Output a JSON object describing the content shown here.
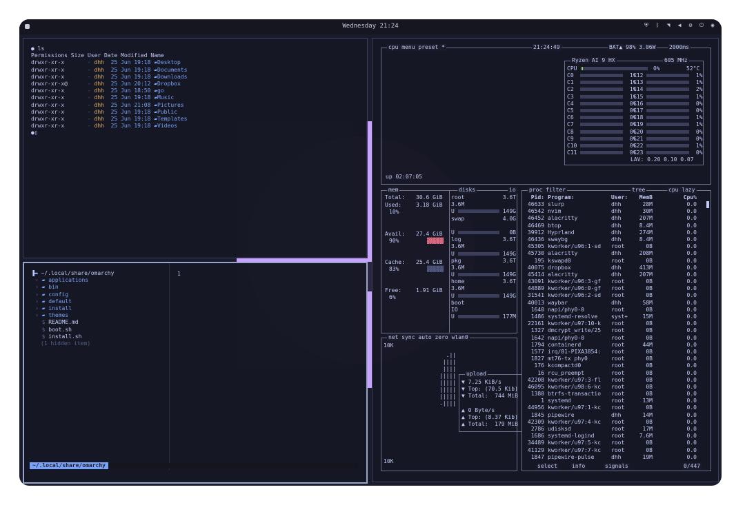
{
  "topbar": {
    "clock": "Wednesday 21:24",
    "tray_icons": [
      "shield-icon",
      "bluetooth-icon",
      "wifi-icon",
      "volume-icon",
      "settings-icon",
      "power-icon",
      "menu-icon"
    ]
  },
  "terminal": {
    "command": "ls",
    "header": "Permissions Size User Date Modified Name",
    "rows": [
      {
        "perm": "drwxr-xr-x",
        "size": "-",
        "user": "dhh",
        "date": "25 Jun 19:18",
        "name": "Desktop"
      },
      {
        "perm": "drwxr-xr-x",
        "size": "-",
        "user": "dhh",
        "date": "25 Jun 19:18",
        "name": "Documents"
      },
      {
        "perm": "drwxr-xr-x",
        "size": "-",
        "user": "dhh",
        "date": "25 Jun 19:18",
        "name": "Downloads"
      },
      {
        "perm": "drwxr-xr-x@",
        "size": "-",
        "user": "dhh",
        "date": "25 Jun 20:12",
        "name": "Dropbox"
      },
      {
        "perm": "drwxr-xr-x",
        "size": "-",
        "user": "dhh",
        "date": "25 Jun 18:50",
        "name": "go"
      },
      {
        "perm": "drwxr-xr-x",
        "size": "-",
        "user": "dhh",
        "date": "25 Jun 19:18",
        "name": "Music"
      },
      {
        "perm": "drwxr-xr-x",
        "size": "-",
        "user": "dhh",
        "date": "25 Jun 21:08",
        "name": "Pictures"
      },
      {
        "perm": "drwxr-xr-x",
        "size": "-",
        "user": "dhh",
        "date": "25 Jun 19:18",
        "name": "Public"
      },
      {
        "perm": "drwxr-xr-x",
        "size": "-",
        "user": "dhh",
        "date": "25 Jun 19:18",
        "name": "Templates"
      },
      {
        "perm": "drwxr-xr-x",
        "size": "-",
        "user": "dhh",
        "date": "25 Jun 19:18",
        "name": "Videos"
      }
    ]
  },
  "yazi": {
    "path": "~/.local/share/omarchy",
    "items": [
      {
        "icon": "folder",
        "name": "applications"
      },
      {
        "icon": "folder",
        "name": "bin"
      },
      {
        "icon": "folder",
        "name": "config"
      },
      {
        "icon": "folder",
        "name": "default"
      },
      {
        "icon": "folder",
        "name": "install"
      },
      {
        "icon": "folder",
        "name": "themes"
      },
      {
        "icon": "file",
        "name": "README.md"
      },
      {
        "icon": "file",
        "name": "boot.sh"
      },
      {
        "icon": "file",
        "name": "install.sh"
      }
    ],
    "hidden": "(1 hidden item)",
    "preview_line": "1",
    "status_path": "~/.local/share/omarchy"
  },
  "btop": {
    "cpu_tabs": [
      "cpu",
      "menu",
      "preset",
      "*"
    ],
    "time": "21:24:49",
    "battery": "BAT▲ 98% 3.06W",
    "refresh": "2000ms",
    "cpu_name": "Ryzen AI 9 HX",
    "freq": "605 MHz",
    "cpu_total": "0%",
    "cpu_temp": "52°C",
    "cores_left": [
      [
        "C0",
        "1%"
      ],
      [
        "C1",
        "1%"
      ],
      [
        "C2",
        "1%"
      ],
      [
        "C3",
        "1%"
      ],
      [
        "C4",
        "0%"
      ],
      [
        "C5",
        "0%"
      ],
      [
        "C6",
        "0%"
      ],
      [
        "C7",
        "0%"
      ],
      [
        "C8",
        "0%"
      ],
      [
        "C9",
        "0%"
      ],
      [
        "C10",
        "0%"
      ],
      [
        "C11",
        "0%"
      ]
    ],
    "cores_right": [
      [
        "C12",
        "1%"
      ],
      [
        "C13",
        "1%"
      ],
      [
        "C14",
        "2%"
      ],
      [
        "C15",
        "1%"
      ],
      [
        "C16",
        "0%"
      ],
      [
        "C17",
        "0%"
      ],
      [
        "C18",
        "1%"
      ],
      [
        "C19",
        "1%"
      ],
      [
        "C20",
        "0%"
      ],
      [
        "C21",
        "0%"
      ],
      [
        "C22",
        "1%"
      ],
      [
        "C23",
        "0%"
      ]
    ],
    "lav": "LAV: 0.20 0.10 0.07",
    "uptime": "up 02:07:05",
    "mem": {
      "title": "mem",
      "disks_title": "disks",
      "io": "io",
      "total": "30.6 GiB",
      "used": "3.18 GiB",
      "used_pct": "10%",
      "avail": "27.4 GiB",
      "avail_pct": "90%",
      "cache": "25.4 GiB",
      "cache_pct": "83%",
      "free": "1.91 GiB",
      "free_pct": "6%"
    },
    "disks": [
      {
        "name": "root",
        "size": "3.6T",
        "a": "3.6M",
        "u": "149G"
      },
      {
        "name": "swap",
        "size": "4.0G",
        "a": "",
        "u": "0B"
      },
      {
        "name": "log",
        "size": "3.6T",
        "a": "3.6M",
        "u": "149G"
      },
      {
        "name": "pkg",
        "size": "3.6T",
        "a": "3.6M",
        "u": "149G"
      },
      {
        "name": "home",
        "size": "3.6T",
        "a": "3.6M",
        "u": "149G"
      },
      {
        "name": "boot",
        "size": "",
        "a": "IO",
        "u": "177M"
      }
    ],
    "net": {
      "title": "net",
      "sync": "sync",
      "auto": "auto",
      "zero": "zero",
      "iface": "wlan0",
      "scale_top": "10K",
      "scale_bottom": "10K",
      "upload_title": "upload",
      "up_rate": "▼ 7.25 KiB/s",
      "up_top": "▼ Top: (70.5 Kib)",
      "up_total": "▼ Total:  744 MiB",
      "down_rate": "▲ 0 Byte/s",
      "down_top": "▲ Top: (8.37 Kib)",
      "down_total": "▲ Total:  179 MiB"
    },
    "proc": {
      "title": "proc",
      "filter": "filter",
      "tree": "tree",
      "sort": "cpu lazy",
      "headers": [
        "Pid:",
        "Program:",
        "User:",
        "MemB",
        "Cpu%"
      ],
      "rows": [
        [
          "46633",
          "slurp",
          "dhh",
          "28M",
          "0.0"
        ],
        [
          "46542",
          "nvim",
          "dhh",
          "30M",
          "0.0"
        ],
        [
          "46452",
          "alacritty",
          "dhh",
          "207M",
          "0.0"
        ],
        [
          "46469",
          "btop",
          "dhh",
          "8.4M",
          "0.0"
        ],
        [
          "39912",
          "Hyprland",
          "dhh",
          "274M",
          "0.0"
        ],
        [
          "46436",
          "swaybg",
          "dhh",
          "8.4M",
          "0.0"
        ],
        [
          "45305",
          "kworker/u96:1-sd",
          "root",
          "0B",
          "0.0"
        ],
        [
          "45730",
          "alacritty",
          "dhh",
          "208M",
          "0.0"
        ],
        [
          "195",
          "kswapd0",
          "root",
          "0B",
          "0.0"
        ],
        [
          "40075",
          "dropbox",
          "dhh",
          "413M",
          "0.0"
        ],
        [
          "45414",
          "alacritty",
          "dhh",
          "207M",
          "0.0"
        ],
        [
          "43091",
          "kworker/u96:3-gf",
          "root",
          "0B",
          "0.0"
        ],
        [
          "44889",
          "kworker/u96:0-gf",
          "root",
          "0B",
          "0.0"
        ],
        [
          "31541",
          "kworker/u96:2-sd",
          "root",
          "0B",
          "0.0"
        ],
        [
          "40013",
          "waybar",
          "dhh",
          "58M",
          "0.0"
        ],
        [
          "1640",
          "napi/phy0-0",
          "root",
          "0B",
          "0.0"
        ],
        [
          "1486",
          "systemd-resolve",
          "syst+",
          "15M",
          "0.0"
        ],
        [
          "22161",
          "kworker/u97:10-k",
          "root",
          "0B",
          "0.0"
        ],
        [
          "1327",
          "dmcrypt_write/25",
          "root",
          "0B",
          "0.0"
        ],
        [
          "1642",
          "napi/phy0-0",
          "root",
          "0B",
          "0.0"
        ],
        [
          "1794",
          "containerd",
          "root",
          "44M",
          "0.0"
        ],
        [
          "1577",
          "irq/81-PIXA3854:",
          "root",
          "0B",
          "0.0"
        ],
        [
          "1827",
          "mt76-tx phy0",
          "root",
          "0B",
          "0.0"
        ],
        [
          "176",
          "kcompactd0",
          "root",
          "0B",
          "0.0"
        ],
        [
          "16",
          "rcu_preempt",
          "root",
          "0B",
          "0.0"
        ],
        [
          "42208",
          "kworker/u97:3-fl",
          "root",
          "0B",
          "0.0"
        ],
        [
          "46095",
          "kworker/u98:6-kc",
          "root",
          "0B",
          "0.0"
        ],
        [
          "1380",
          "btrfs-transactio",
          "root",
          "0B",
          "0.0"
        ],
        [
          "1",
          "systemd",
          "root",
          "13M",
          "0.0"
        ],
        [
          "44956",
          "kworker/u97:1-kc",
          "root",
          "0B",
          "0.0"
        ],
        [
          "1845",
          "pipewire",
          "dhh",
          "14M",
          "0.0"
        ],
        [
          "42309",
          "kworker/u97:4-kc",
          "root",
          "0B",
          "0.0"
        ],
        [
          "2786",
          "udisksd",
          "root",
          "17M",
          "0.0"
        ],
        [
          "1686",
          "systemd-logind",
          "root",
          "7.6M",
          "0.0"
        ],
        [
          "34489",
          "kworker/u97:5-kc",
          "root",
          "0B",
          "0.0"
        ],
        [
          "41129",
          "kworker/u97:7-kc",
          "root",
          "0B",
          "0.0"
        ],
        [
          "1847",
          "pipewire-pulse",
          "dhh",
          "19M",
          "0.0"
        ]
      ],
      "footer_select": "select",
      "footer_info": "info",
      "footer_signals": "signals",
      "count": "0/447"
    }
  }
}
